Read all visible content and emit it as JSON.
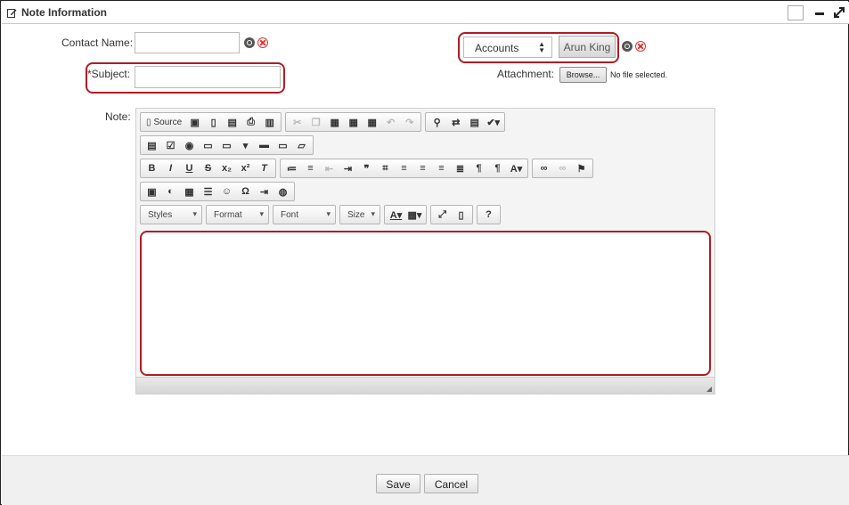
{
  "header": {
    "title": "Note Information"
  },
  "form": {
    "contact_name_label": "Contact Name:",
    "subject_required_mark": "*",
    "subject_label": "Subject:",
    "note_label": "Note:",
    "related_to": {
      "selected": "Accounts",
      "value_button": "Arun King"
    },
    "attachment_label": "Attachment:",
    "browse_label": "Browse...",
    "no_file_text": "No file selected."
  },
  "editor": {
    "source_label": "Source",
    "combos": [
      "Styles",
      "Format",
      "Font",
      "Size"
    ],
    "help_label": "?"
  },
  "footer": {
    "save_label": "Save",
    "cancel_label": "Cancel"
  },
  "colors": {
    "highlight": "#b01c24"
  }
}
